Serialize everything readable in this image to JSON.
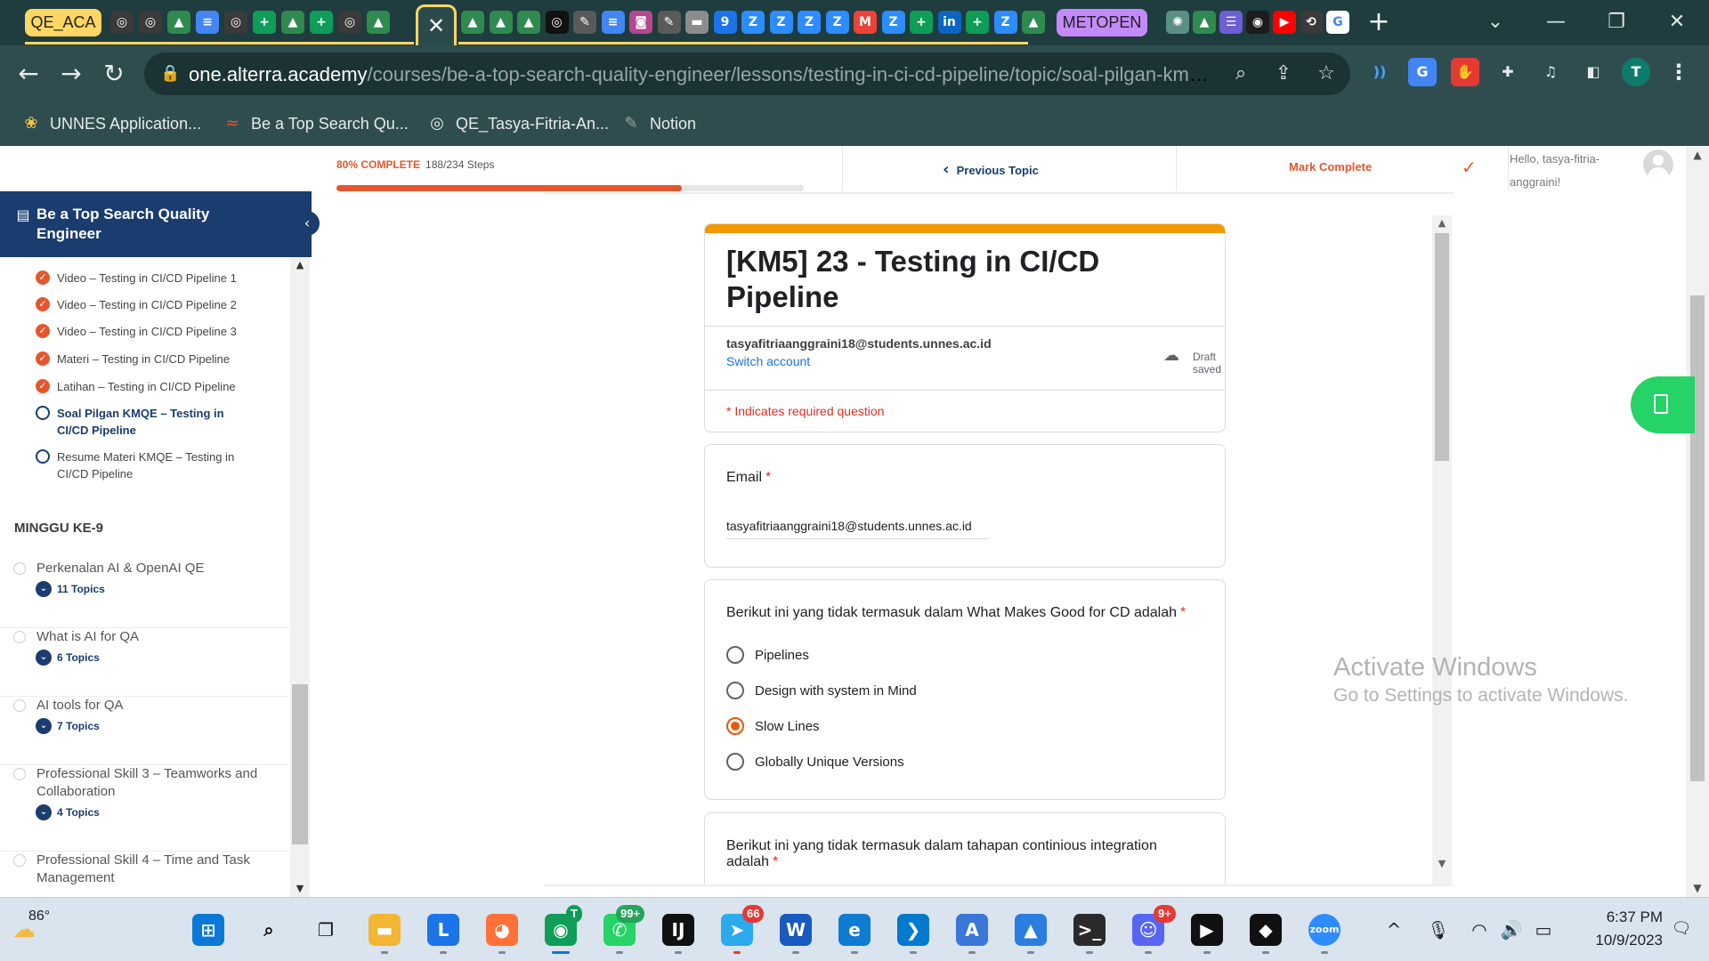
{
  "tabstrip": {
    "group_qe": "QE_ACA",
    "group_metopen": "METOPEN",
    "active_tab_icon": "close-icon",
    "icons": [
      {
        "name": "github-icon",
        "color": "#3a3a3a",
        "glyph": "◎"
      },
      {
        "name": "github-icon",
        "color": "#3a3a3a",
        "glyph": "◎"
      },
      {
        "name": "drive-icon",
        "color": "#2f8a4f",
        "glyph": "▲"
      },
      {
        "name": "docs-icon",
        "color": "#4285f4",
        "glyph": "≡"
      },
      {
        "name": "github-icon",
        "color": "#3a3a3a",
        "glyph": "◎"
      },
      {
        "name": "sheets-icon",
        "color": "#0f9d58",
        "glyph": "+"
      },
      {
        "name": "drive-icon",
        "color": "#2f8a4f",
        "glyph": "▲"
      },
      {
        "name": "sheets-icon",
        "color": "#0f9d58",
        "glyph": "+"
      },
      {
        "name": "github-icon",
        "color": "#3a3a3a",
        "glyph": "◎"
      },
      {
        "name": "drive-icon",
        "color": "#2f8a4f",
        "glyph": "▲"
      }
    ],
    "icons_right": [
      {
        "name": "drive-icon",
        "color": "#2f8a4f",
        "glyph": "▲"
      },
      {
        "name": "drive-icon",
        "color": "#2f8a4f",
        "glyph": "▲"
      },
      {
        "name": "drive-icon",
        "color": "#2f8a4f",
        "glyph": "▲"
      },
      {
        "name": "github-icon",
        "color": "#111111",
        "glyph": "◎"
      },
      {
        "name": "notion-icon",
        "color": "#5a5a5a",
        "glyph": "✎"
      },
      {
        "name": "docs-icon",
        "color": "#4285f4",
        "glyph": "≡"
      },
      {
        "name": "instagram-icon",
        "color": "#b4478f",
        "glyph": "◙"
      },
      {
        "name": "notion-icon",
        "color": "#5a5a5a",
        "glyph": "✎"
      },
      {
        "name": "slides-icon",
        "color": "#8c8c8c",
        "glyph": "▬"
      },
      {
        "name": "calendar-icon",
        "color": "#1a73e8",
        "glyph": "9"
      },
      {
        "name": "zoom-icon",
        "color": "#2d8cff",
        "glyph": "Z"
      },
      {
        "name": "zoom-icon",
        "color": "#2d8cff",
        "glyph": "Z"
      },
      {
        "name": "zoom-icon",
        "color": "#2d8cff",
        "glyph": "Z"
      },
      {
        "name": "zoom-icon",
        "color": "#2d8cff",
        "glyph": "Z"
      },
      {
        "name": "gmail-icon",
        "color": "#ea4335",
        "glyph": "M"
      },
      {
        "name": "zoom-icon",
        "color": "#2d8cff",
        "glyph": "Z"
      },
      {
        "name": "sheets-icon",
        "color": "#0f9d58",
        "glyph": "+"
      },
      {
        "name": "linkedin-icon",
        "color": "#0a66c2",
        "glyph": "in"
      },
      {
        "name": "sheets-icon",
        "color": "#0f9d58",
        "glyph": "+"
      },
      {
        "name": "zoom-icon",
        "color": "#2d8cff",
        "glyph": "Z"
      },
      {
        "name": "drive-icon",
        "color": "#2f8a4f",
        "glyph": "▲"
      }
    ],
    "icons_after": [
      {
        "name": "chatgpt-icon",
        "color": "#5a8f86",
        "glyph": "✺"
      },
      {
        "name": "drive-icon",
        "color": "#2f8a4f",
        "glyph": "▲"
      },
      {
        "name": "tasks-icon",
        "color": "#6b5fd3",
        "glyph": "☰"
      },
      {
        "name": "spotify-icon",
        "color": "#1c1c1c",
        "glyph": "◉"
      },
      {
        "name": "youtube-icon",
        "color": "#ff0000",
        "glyph": "▶"
      },
      {
        "name": "history-icon",
        "color": "#3a3a3a",
        "glyph": "⟲"
      },
      {
        "name": "google-icon",
        "color": "#ffffff",
        "glyph": "G"
      }
    ],
    "new_tab_glyph": "+",
    "tab_search_glyph": "⌄",
    "minimize_glyph": "—",
    "restore_glyph": "❐",
    "close_glyph": "✕"
  },
  "toolbar": {
    "back_glyph": "←",
    "forward_glyph": "→",
    "reload_glyph": "↻",
    "lock_glyph": "🔒",
    "url_host": "one.alterra.academy",
    "url_path": "/courses/be-a-top-search-quality-engineer/lessons/testing-in-ci-cd-pipeline/topic/soal-pilgan-kmqe-t...",
    "zoom_glyph": "⌕",
    "share_glyph": "⇪",
    "star_glyph": "☆",
    "profile_initial": "T",
    "menu_glyph": "⋮",
    "extensions": [
      {
        "name": "read-aloud-icon",
        "color": "#2f4d4f",
        "glyph": "))",
        "fg": "#4aa3ff"
      },
      {
        "name": "translate-icon",
        "color": "#4285f4",
        "glyph": "G",
        "fg": "#ffffff"
      },
      {
        "name": "adblock-icon",
        "color": "#e53935",
        "glyph": "✋",
        "fg": "#ffffff"
      },
      {
        "name": "extensions-puzzle-icon",
        "color": "#2f4d4f",
        "glyph": "✚",
        "fg": "#e8eaed"
      },
      {
        "name": "media-control-icon",
        "color": "#2f4d4f",
        "glyph": "♫",
        "fg": "#e8eaed"
      },
      {
        "name": "side-panel-icon",
        "color": "#2f4d4f",
        "glyph": "◧",
        "fg": "#e8eaed"
      }
    ]
  },
  "bookmarks": [
    {
      "label": "UNNES Application...",
      "icon": "unnes-icon",
      "glyph": "❀",
      "color": "#f5c542"
    },
    {
      "label": "Be a Top Search Qu...",
      "icon": "alterra-icon",
      "glyph": "≈",
      "color": "#e4572e"
    },
    {
      "label": "QE_Tasya-Fitria-An...",
      "icon": "github-icon",
      "glyph": "◎",
      "color": "#e8eaed"
    },
    {
      "label": "Notion",
      "icon": "notion-icon",
      "glyph": "✎",
      "color": "#9aa6a6"
    }
  ],
  "lms": {
    "progress_label": "80% COMPLETE",
    "progress_steps": "188/234 Steps",
    "progress_value": 0.8,
    "previous_topic": "Previous Topic",
    "previous_glyph": "‹",
    "mark_complete": "Mark Complete",
    "mark_glyph": "✓",
    "hello": "Hello, tasya-fitria-anggraini!",
    "course_title": "Be a Top Search Quality Engineer",
    "course_icon_glyph": "▤",
    "collapse_glyph": "‹",
    "scroll_up_glyph": "▲",
    "scroll_down_glyph": "▼",
    "lessons": [
      {
        "title": "Video – Testing in CI/CD Pipeline 1",
        "status": "done"
      },
      {
        "title": "Video – Testing in CI/CD Pipeline 2",
        "status": "done"
      },
      {
        "title": "Video – Testing in CI/CD Pipeline 3",
        "status": "done"
      },
      {
        "title": "Materi – Testing in CI/CD Pipeline",
        "status": "done"
      },
      {
        "title": "Latihan – Testing in CI/CD Pipeline",
        "status": "done"
      },
      {
        "title": "Soal Pilgan KMQE – Testing in CI/CD Pipeline",
        "status": "current"
      },
      {
        "title": "Resume Materi KMQE – Testing in CI/CD Pipeline",
        "status": "todo"
      }
    ],
    "done_glyph": "✓",
    "week_title": "MINGGU KE-9",
    "modules": [
      {
        "name": "Perkenalan AI & OpenAI QE",
        "topics": "11 Topics"
      },
      {
        "name": "What is AI for QA",
        "topics": "6 Topics"
      },
      {
        "name": "AI tools for QA",
        "topics": "7 Topics"
      },
      {
        "name": "Professional Skill 3 – Teamworks and Collaboration",
        "topics": "4 Topics"
      },
      {
        "name": "Professional Skill 4 – Time and Task Management",
        "topics": ""
      }
    ],
    "topics_chevron": "⌄"
  },
  "form": {
    "title": "[KM5] 23 - Testing in CI/CD Pipeline",
    "account_email": "tasyafitriaanggraini18@students.unnes.ac.id",
    "switch_account": "Switch account",
    "cloud_glyph": "☁",
    "draft_saved": "Draft saved",
    "required_note": "* Indicates required question",
    "email_label": "Email",
    "required_star": "*",
    "email_value": "tasyafitriaanggraini18@students.unnes.ac.id",
    "q1": {
      "text": "Berikut ini yang tidak termasuk dalam What Makes Good for CD adalah",
      "options": [
        "Pipelines",
        "Design with system in Mind",
        "Slow Lines",
        "Globally Unique Versions"
      ],
      "selected": 2
    },
    "q2": {
      "text": "Berikut ini yang tidak termasuk dalam tahapan continious integration adalah"
    }
  },
  "watermark": {
    "title": "Activate Windows",
    "subtitle": "Go to Settings to activate Windows."
  },
  "taskbar": {
    "weather_temp": "86°",
    "weather_glyph": "☁",
    "time": "6:37 PM",
    "date": "10/9/2023",
    "apps": [
      {
        "name": "start-icon",
        "color": "#0a78d7",
        "glyph": "⊞"
      },
      {
        "name": "search-icon",
        "color": "#d9e4ee",
        "glyph": "⌕",
        "fg": "#111111"
      },
      {
        "name": "task-view-icon",
        "color": "#d9e4ee",
        "glyph": "❐",
        "fg": "#111111"
      },
      {
        "name": "file-explorer-icon",
        "color": "#f2b632",
        "glyph": "▬"
      },
      {
        "name": "lark-icon",
        "color": "#1b74e8",
        "glyph": "L"
      },
      {
        "name": "firefox-icon",
        "color": "#ff7139",
        "glyph": "◕"
      },
      {
        "name": "chrome-icon",
        "color": "#0f9d58",
        "glyph": "◉"
      },
      {
        "name": "whatsapp-icon",
        "color": "#25d366",
        "glyph": "✆"
      },
      {
        "name": "intellij-icon",
        "color": "#111111",
        "glyph": "IJ"
      },
      {
        "name": "telegram-icon",
        "color": "#2aabee",
        "glyph": "➤"
      },
      {
        "name": "word-icon",
        "color": "#185abd",
        "glyph": "W"
      },
      {
        "name": "edge-icon",
        "color": "#0f7bd2",
        "glyph": "e"
      },
      {
        "name": "vscode-icon",
        "color": "#007acc",
        "glyph": "❯"
      },
      {
        "name": "app-store-icon",
        "color": "#3a77d8",
        "glyph": "A"
      },
      {
        "name": "photos-icon",
        "color": "#2b7de0",
        "glyph": "▲"
      },
      {
        "name": "terminal-icon",
        "color": "#2a2a2a",
        "glyph": ">_"
      },
      {
        "name": "discord-icon",
        "color": "#5865f2",
        "glyph": "☺"
      },
      {
        "name": "media-player-icon",
        "color": "#111111",
        "glyph": "▶"
      },
      {
        "name": "inkscape-icon",
        "color": "#111111",
        "glyph": "◆"
      },
      {
        "name": "zoom-app-icon",
        "color": "#2d8cff",
        "glyph": "zoom"
      }
    ],
    "badge_chrome": "T",
    "badge_whatsapp": "99+",
    "badge_telegram": "66",
    "badge_discord": "9+",
    "tray": {
      "chevron_glyph": "^",
      "mic_glyph": "🎙",
      "wifi_glyph": "◠",
      "volume_glyph": "🔊",
      "battery_glyph": "▭",
      "notif_glyph": "🗨"
    }
  }
}
